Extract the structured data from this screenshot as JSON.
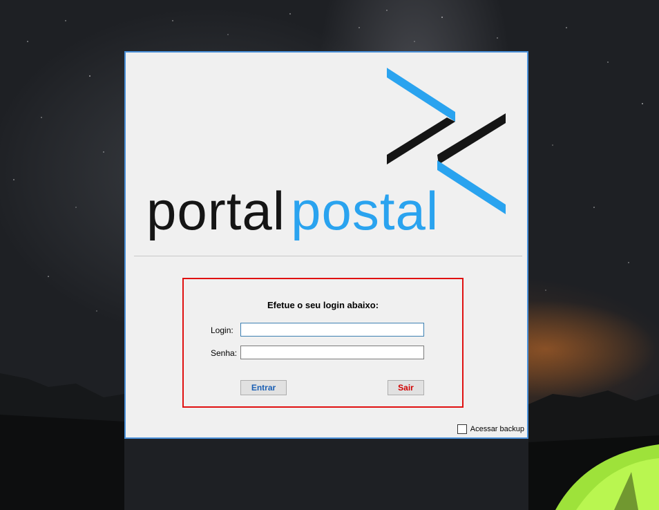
{
  "app": {
    "logo_word_dark": "portal",
    "logo_word_blue": "postal",
    "logo_icon": "double-chevron-logo",
    "colors": {
      "brand_blue": "#2aa3ef",
      "brand_dark": "#151515",
      "highlight_red": "#e01010",
      "window_border": "#4a90d9"
    }
  },
  "login": {
    "title": "Efetue o seu login abaixo:",
    "login_label": "Login:",
    "login_value": "",
    "password_label": "Senha:",
    "password_value": "",
    "enter_button": "Entrar",
    "exit_button": "Sair",
    "enter_color": "#1a5fb4",
    "exit_color": "#d00000"
  },
  "backup": {
    "label": "Acessar backup",
    "checked": false
  }
}
